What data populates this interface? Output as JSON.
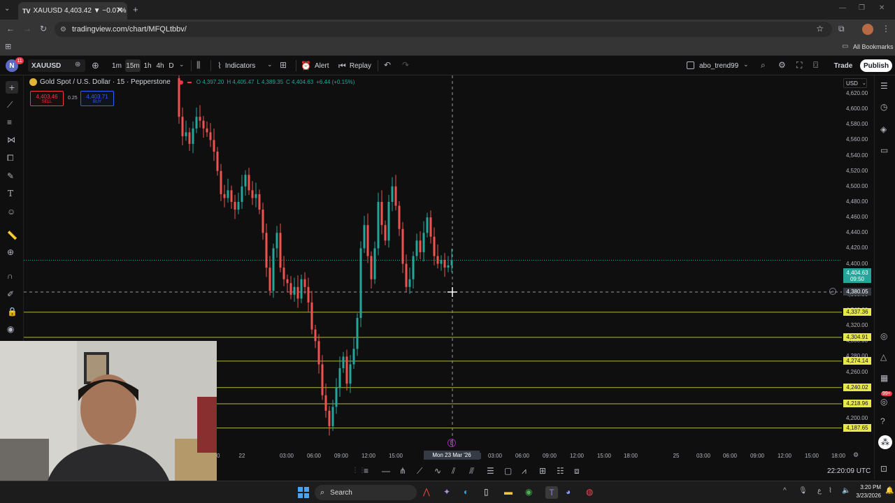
{
  "browser": {
    "tab_title": "XAUUSD 4,403.42 ▼ −0.07% al...",
    "url": "tradingview.com/chart/MFQLtbbv/",
    "bookmarks_label": "All Bookmarks",
    "notification_count": "11"
  },
  "toolbar": {
    "symbol": "XAUUSD",
    "intervals": [
      "1m",
      "15m",
      "1h",
      "4h",
      "D"
    ],
    "active_interval": "15m",
    "indicators_label": "Indicators",
    "alert_label": "Alert",
    "replay_label": "Replay",
    "layout_name": "abo_trend99",
    "trade_label": "Trade",
    "publish_label": "Publish"
  },
  "legend": {
    "title": "Gold Spot / U.S. Dollar · 15 · Pepperstone",
    "open": "O 4,397.20",
    "high": "H 4,405.47",
    "low": "L 4,389.35",
    "close": "C 4,404.63",
    "change": "+6.44 (+0.15%)",
    "sell_price": "4,403.46",
    "sell_label": "SELL",
    "spread": "0.25",
    "buy_price": "4,403.71",
    "buy_label": "BUY"
  },
  "price_axis": {
    "currency": "USD",
    "ticks": [
      "4,620.00",
      "4,600.00",
      "4,580.00",
      "4,560.00",
      "4,540.00",
      "4,520.00",
      "4,500.00",
      "4,480.00",
      "4,460.00",
      "4,440.00",
      "4,420.00",
      "4,400.00",
      "4,380.00",
      "4,360.00",
      "4,340.00",
      "4,320.00",
      "4,300.00",
      "4,280.00",
      "4,260.00",
      "4,240.00",
      "4,220.00",
      "4,200.00"
    ],
    "current_price": "4,404.63",
    "countdown": "09:50",
    "crosshair_price": "4,380.05",
    "horizontal_levels": [
      "4,337.36",
      "4,304.91",
      "4,274.14",
      "4,240.02",
      "4,218.96",
      "4,187.65"
    ]
  },
  "time_axis": {
    "ticks": [
      "00",
      "22",
      "03:00",
      "06:00",
      "09:00",
      "12:00",
      "15:00",
      "18",
      "22:15",
      "03:00",
      "06:00",
      "09:00",
      "12:00",
      "15:00",
      "18:00",
      "25",
      "03:00",
      "06:00",
      "09:00",
      "12:00",
      "15:00",
      "18:00"
    ],
    "crosshair_date": "Mon 23 Mar '26",
    "clock": "22:20:09 UTC"
  },
  "taskbar": {
    "search_placeholder": "Search",
    "time": "3:20 PM",
    "date": "3/23/2026",
    "discord_badge": "99+"
  },
  "colors": {
    "up": "#26a69a",
    "down": "#ef5350",
    "level_line": "#d4d44a",
    "accent": "#2962ff"
  }
}
